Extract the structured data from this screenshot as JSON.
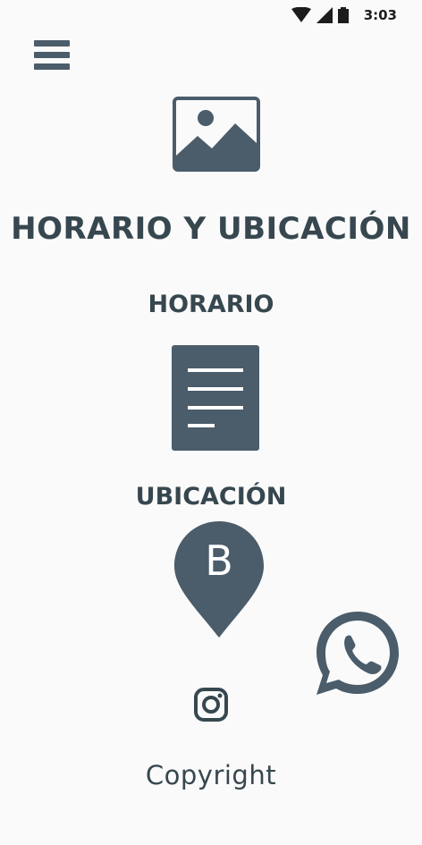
{
  "status_bar": {
    "time": "3:03",
    "icons": [
      "wifi-icon",
      "signal-icon",
      "battery-icon"
    ]
  },
  "header": {
    "menu_icon": "hamburger-menu-icon"
  },
  "hero": {
    "image_icon": "image-placeholder-icon"
  },
  "page": {
    "title": "HORARIO Y UBICACIÓN"
  },
  "sections": {
    "horario": {
      "title": "HORARIO",
      "icon": "document-icon"
    },
    "ubicacion": {
      "title": "UBICACIÓN",
      "icon": "map-pin-icon",
      "pin_letter": "B"
    }
  },
  "floating": {
    "whatsapp_icon": "whatsapp-icon"
  },
  "footer": {
    "instagram_icon": "instagram-icon",
    "copyright": "Copyright"
  },
  "colors": {
    "primary": "#4b5c6a",
    "text": "#37474f",
    "background": "#fafafa"
  }
}
